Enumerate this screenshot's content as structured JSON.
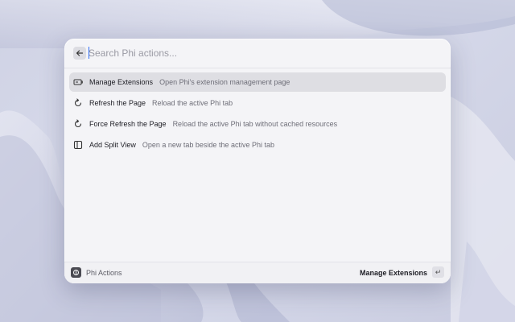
{
  "search": {
    "placeholder": "Search Phi actions..."
  },
  "actions": [
    {
      "title": "Manage Extensions",
      "description": "Open Phi's extension management page",
      "icon": "extension-icon",
      "selected": true
    },
    {
      "title": "Refresh the Page",
      "description": "Reload the active Phi tab",
      "icon": "refresh-icon",
      "selected": false
    },
    {
      "title": "Force Refresh the Page",
      "description": "Reload the active Phi tab without cached resources",
      "icon": "refresh-icon",
      "selected": false
    },
    {
      "title": "Add Split View",
      "description": "Open a new tab beside the active Phi tab",
      "icon": "split-view-icon",
      "selected": false
    }
  ],
  "footer": {
    "app_label": "Phi Actions",
    "primary_action": "Manage Extensions",
    "return_key": "↵"
  },
  "colors": {
    "accent": "#2f6cf5",
    "selected_row": "#dedee3"
  }
}
